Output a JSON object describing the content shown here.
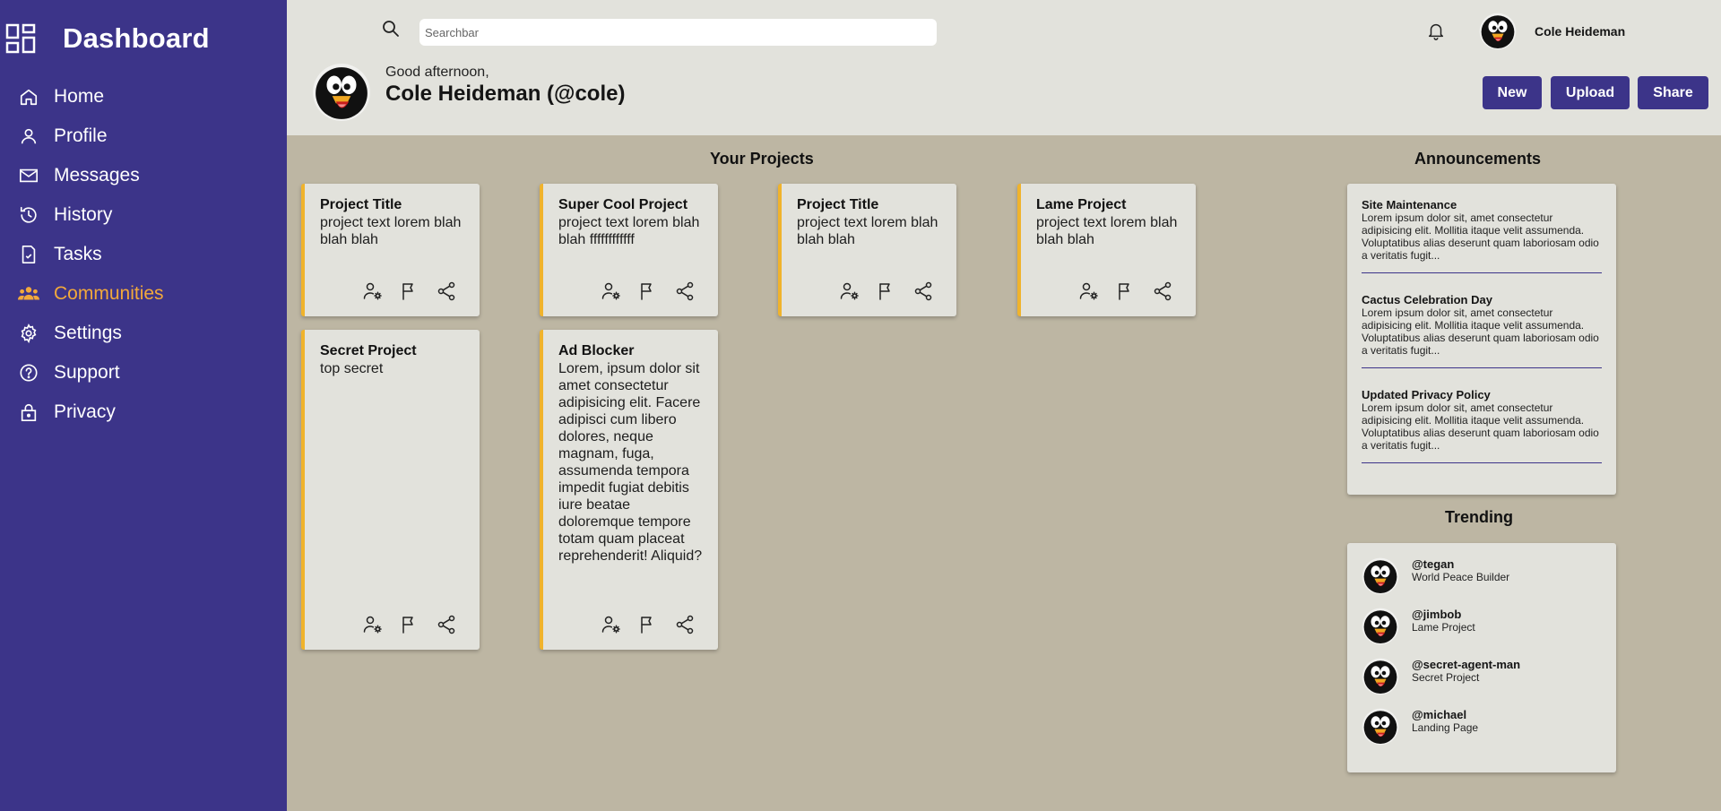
{
  "sidebar": {
    "title": "Dashboard",
    "items": [
      {
        "label": "Home",
        "icon": "home-icon"
      },
      {
        "label": "Profile",
        "icon": "profile-icon"
      },
      {
        "label": "Messages",
        "icon": "mail-icon"
      },
      {
        "label": "History",
        "icon": "history-icon"
      },
      {
        "label": "Tasks",
        "icon": "tasks-icon"
      },
      {
        "label": "Communities",
        "icon": "communities-icon",
        "active": true
      },
      {
        "label": "Settings",
        "icon": "gear-icon"
      },
      {
        "label": "Support",
        "icon": "help-icon"
      },
      {
        "label": "Privacy",
        "icon": "lock-icon"
      }
    ]
  },
  "header": {
    "search_placeholder": "Searchbar",
    "username": "Cole Heideman",
    "greeting": "Good afternoon,",
    "full_name": "Cole Heideman (@cole)",
    "buttons": {
      "new": "New",
      "upload": "Upload",
      "share": "Share"
    }
  },
  "projects_title": "Your Projects",
  "projects": [
    {
      "title": "Project Title",
      "text": "project text lorem blah blah blah"
    },
    {
      "title": "Super Cool Project",
      "text": "project text lorem blah blah ffffffffffff"
    },
    {
      "title": "Project Title",
      "text": "project text lorem blah blah blah"
    },
    {
      "title": "Lame Project",
      "text": "project text lorem blah blah blah"
    },
    {
      "title": "Secret Project",
      "text": "top secret"
    },
    {
      "title": "Ad Blocker",
      "text": "Lorem, ipsum dolor sit amet consectetur adipisicing elit. Facere adipisci cum libero dolores, neque magnam, fuga, assumenda tempora impedit fugiat debitis iure beatae doloremque tempore totam quam placeat reprehenderit! Aliquid?"
    }
  ],
  "announcements_title": "Announcements",
  "announcements": [
    {
      "title": "Site Maintenance",
      "text": "Lorem ipsum dolor sit, amet consectetur adipisicing elit. Mollitia itaque velit assumenda. Voluptatibus alias deserunt quam laboriosam odio a veritatis fugit..."
    },
    {
      "title": "Cactus Celebration Day",
      "text": "Lorem ipsum dolor sit, amet consectetur adipisicing elit. Mollitia itaque velit assumenda. Voluptatibus alias deserunt quam laboriosam odio a veritatis fugit..."
    },
    {
      "title": "Updated Privacy Policy",
      "text": "Lorem ipsum dolor sit, amet consectetur adipisicing elit. Mollitia itaque velit assumenda. Voluptatibus alias deserunt quam laboriosam odio a veritatis fugit..."
    }
  ],
  "trending_title": "Trending",
  "trending": [
    {
      "handle": "@tegan",
      "project": "World Peace Builder"
    },
    {
      "handle": "@jimbob",
      "project": "Lame Project"
    },
    {
      "handle": "@secret-agent-man",
      "project": "Secret Project"
    },
    {
      "handle": "@michael",
      "project": "Landing Page"
    }
  ],
  "colors": {
    "sidebar": "#3c3489",
    "accent": "#f2a93b",
    "card_border": "#f0b32c",
    "background": "#bdb6a3",
    "header": "#e2e2dc"
  }
}
